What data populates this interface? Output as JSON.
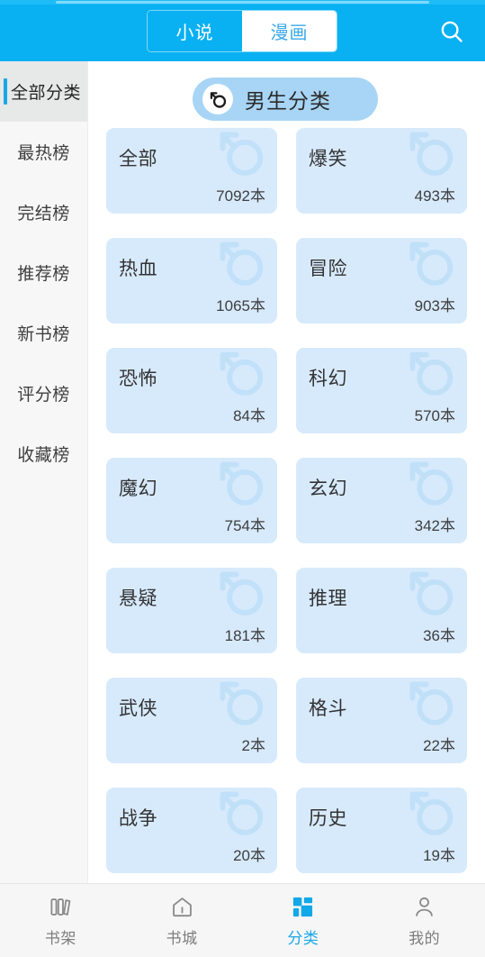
{
  "header": {
    "tabs": [
      {
        "label": "小说",
        "active": false
      },
      {
        "label": "漫画",
        "active": true
      }
    ],
    "search_icon": "search-icon",
    "accent_color": "#09b0f2"
  },
  "sidebar": {
    "items": [
      {
        "label": "全部分类",
        "active": true
      },
      {
        "label": "最热榜",
        "active": false
      },
      {
        "label": "完结榜",
        "active": false
      },
      {
        "label": "推荐榜",
        "active": false
      },
      {
        "label": "新书榜",
        "active": false
      },
      {
        "label": "评分榜",
        "active": false
      },
      {
        "label": "收藏榜",
        "active": false
      }
    ],
    "active_bar_color": "#1aa7e8",
    "active_bg_color": "#e7e8e8"
  },
  "main": {
    "section_pill": {
      "label": "男生分类",
      "icon": "male-symbol-icon",
      "pill_color": "#a8d5f5",
      "dot_color": "#f6e327"
    },
    "card_color": "#d7eafc",
    "unit": "本",
    "cards": [
      {
        "title": "全部",
        "count": "7092本"
      },
      {
        "title": "爆笑",
        "count": "493本"
      },
      {
        "title": "热血",
        "count": "1065本"
      },
      {
        "title": "冒险",
        "count": "903本"
      },
      {
        "title": "恐怖",
        "count": "84本"
      },
      {
        "title": "科幻",
        "count": "570本"
      },
      {
        "title": "魔幻",
        "count": "754本"
      },
      {
        "title": "玄幻",
        "count": "342本"
      },
      {
        "title": "悬疑",
        "count": "181本"
      },
      {
        "title": "推理",
        "count": "36本"
      },
      {
        "title": "武侠",
        "count": "2本"
      },
      {
        "title": "格斗",
        "count": "22本"
      },
      {
        "title": "战争",
        "count": "20本"
      },
      {
        "title": "历史",
        "count": "19本"
      }
    ]
  },
  "bottom_nav": {
    "items": [
      {
        "label": "书架",
        "icon": "bookshelf-icon",
        "active": false
      },
      {
        "label": "书城",
        "icon": "home-icon",
        "active": false
      },
      {
        "label": "分类",
        "icon": "grid-icon",
        "active": true
      },
      {
        "label": "我的",
        "icon": "person-icon",
        "active": false
      }
    ],
    "active_color": "#1aa7e8",
    "inactive_color": "#7d7d7d"
  }
}
